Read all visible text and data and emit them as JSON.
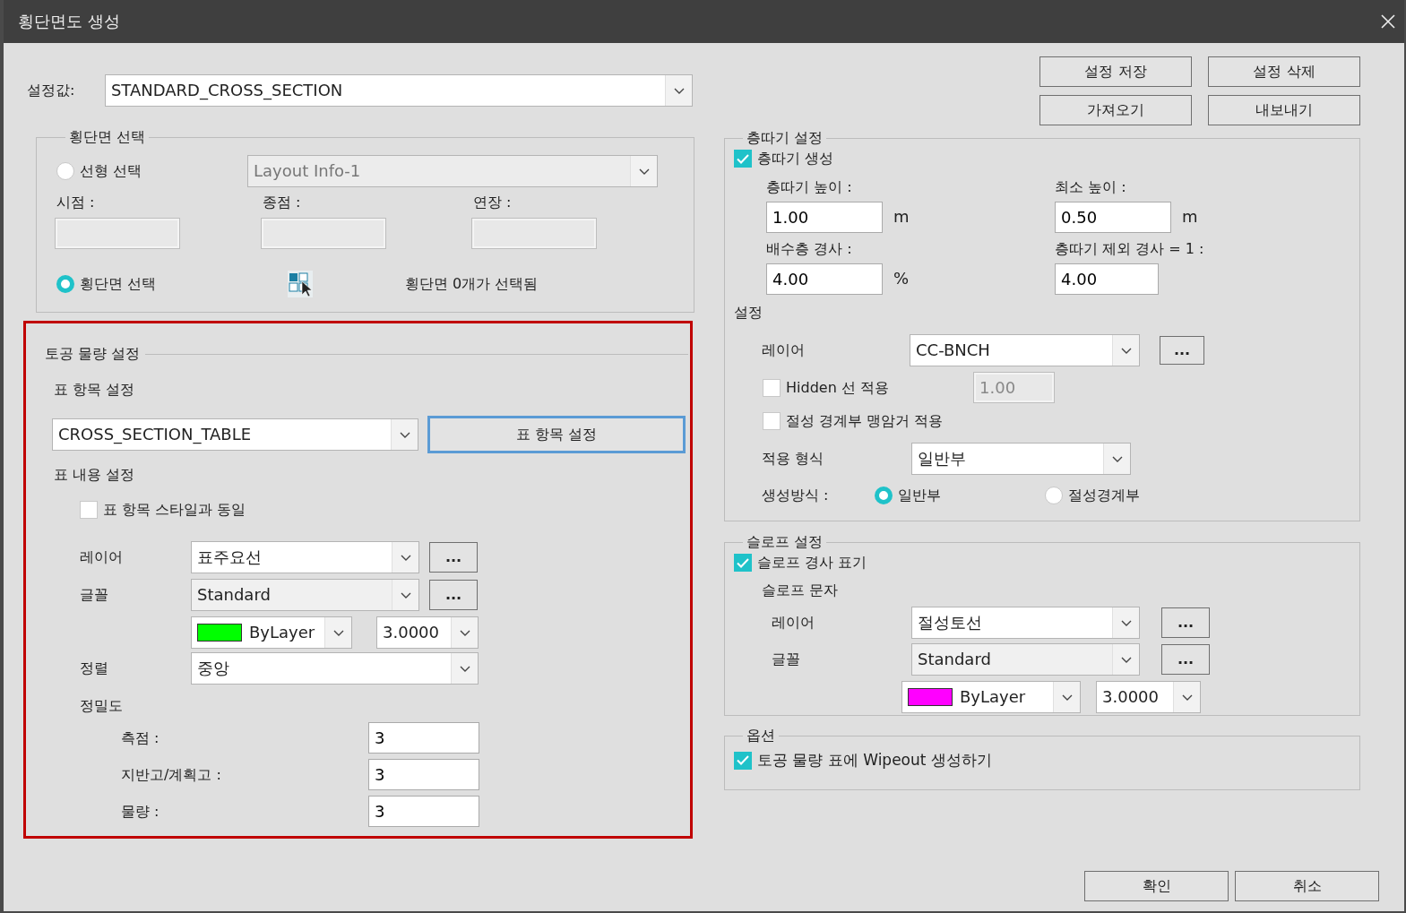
{
  "window": {
    "title": "횡단면도 생성"
  },
  "preset": {
    "label": "설정값:",
    "value": "STANDARD_CROSS_SECTION"
  },
  "preset_buttons": [
    {
      "label": "설정 저장"
    },
    {
      "label": "설정 삭제"
    },
    {
      "label": "가져오기"
    },
    {
      "label": "내보내기"
    }
  ],
  "section_select": {
    "title": "횡단면 선택",
    "alignment_option": {
      "label": "선형 선택",
      "selected": false
    },
    "alignment_combo": {
      "value": "Layout Info-1",
      "disabled": true
    },
    "range_fields": [
      {
        "label": "시점 :",
        "disabled": true
      },
      {
        "label": "종점 :",
        "disabled": true
      },
      {
        "label": "연장 :",
        "disabled": true
      }
    ],
    "section_option": {
      "label": "횡단면 선택",
      "selected": true
    },
    "status": "횡단면 0개가 선택됨"
  },
  "earthwork": {
    "title": "토공 물량 설정",
    "highlighted": true,
    "table_items_label": "표 항목 설정",
    "table_combo": {
      "value": "CROSS_SECTION_TABLE"
    },
    "table_items_button": {
      "label": "표 항목 설정",
      "focused": true
    },
    "content_label": "표 내용 설정",
    "same_style": {
      "label": "표 항목 스타일과 동일",
      "checked": false
    },
    "layer": {
      "label": "레이어",
      "value": "표주요선",
      "more": "..."
    },
    "font": {
      "label": "글꼴",
      "value": "Standard",
      "more": "..."
    },
    "color": {
      "value": "ByLayer",
      "color": "#00ff00"
    },
    "text_height": {
      "value": "3.0000"
    },
    "align": {
      "label": "정렬",
      "value": "중앙"
    },
    "precision_label": "정밀도",
    "precision": [
      {
        "label": "측점 :",
        "value": "3"
      },
      {
        "label": "지반고/계획고 :",
        "value": "3"
      },
      {
        "label": "물량 :",
        "value": "3"
      }
    ]
  },
  "bench": {
    "title": "층따기 설정",
    "generate": {
      "label": "층따기 생성",
      "checked": true
    },
    "fields": [
      {
        "label": "층따기 높이 :",
        "value": "1.00",
        "unit": "m"
      },
      {
        "label": "최소 높이 :",
        "value": "0.50",
        "unit": "m"
      },
      {
        "label": "배수층 경사 :",
        "value": "4.00",
        "unit": "%"
      },
      {
        "label": "층따기 제외 경사 = 1 :",
        "value": "4.00"
      }
    ],
    "settings_label": "설정",
    "layer": {
      "label": "레이어",
      "value": "CC-BNCH",
      "more": "..."
    },
    "hidden_line": {
      "label": "Hidden 선 적용",
      "checked": false,
      "value": "1.00",
      "disabled": true
    },
    "drain": {
      "label": "절성 경계부 맹암거 적용",
      "checked": false
    },
    "apply_type": {
      "label": "적용 형식",
      "value": "일반부"
    },
    "method": {
      "label": "생성방식 :",
      "options": [
        {
          "label": "일반부",
          "selected": true
        },
        {
          "label": "절성경계부",
          "selected": false
        }
      ]
    }
  },
  "slope": {
    "title": "슬로프 설정",
    "show": {
      "label": "슬로프 경사 표기",
      "checked": true
    },
    "text_label": "슬로프 문자",
    "layer": {
      "label": "레이어",
      "value": "절성토선",
      "more": "..."
    },
    "font": {
      "label": "글꼴",
      "value": "Standard",
      "more": "..."
    },
    "color": {
      "value": "ByLayer",
      "color": "#ff00ff"
    },
    "text_height": {
      "value": "3.0000"
    }
  },
  "options": {
    "title": "옵션",
    "wipeout": {
      "label": "토공 물량 표에 Wipeout 생성하기",
      "checked": true
    }
  },
  "footer_buttons": [
    {
      "label": "확인"
    },
    {
      "label": "취소"
    }
  ]
}
